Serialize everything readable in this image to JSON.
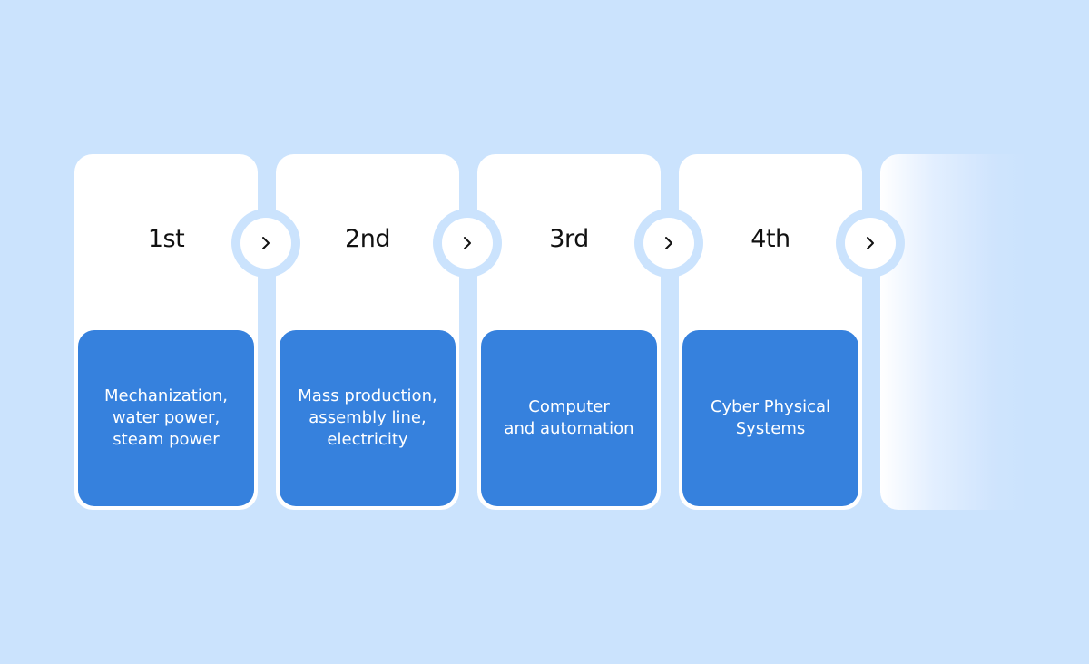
{
  "diagram": {
    "type": "industrial-revolution-timeline",
    "colors": {
      "background": "#cbe3fd",
      "card": "#ffffff",
      "accent": "#3681dd",
      "text_dark": "#111111",
      "text_light": "#ffffff"
    },
    "stages": [
      {
        "ordinal": "1st",
        "description": "Mechanization,\nwater power,\nsteam power"
      },
      {
        "ordinal": "2nd",
        "description": "Mass production,\nassembly line,\nelectricity"
      },
      {
        "ordinal": "3rd",
        "description": "Computer\nand automation"
      },
      {
        "ordinal": "4th",
        "description": "Cyber Physical\nSystems"
      }
    ],
    "connector_icon": "chevron-right-icon",
    "next_stage_placeholder": {
      "label": ""
    }
  }
}
